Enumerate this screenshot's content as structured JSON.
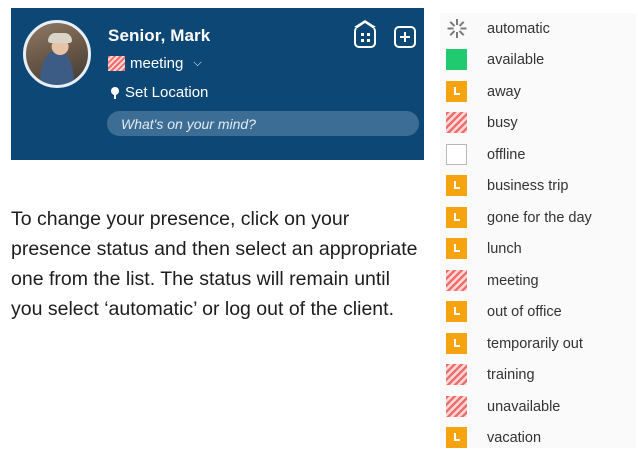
{
  "profile": {
    "name": "Senior, Mark",
    "status_label": "meeting",
    "location_label": "Set Location",
    "mind_placeholder": "What's on your mind?",
    "icons": {
      "status": "hatched-busy-swatch",
      "dropdown": "chevron-down-icon",
      "location": "map-pin-icon",
      "apps": "apps-grid-icon",
      "add": "plus-icon"
    },
    "colors": {
      "card_background": "#0d4775"
    }
  },
  "description": "To change your presence, click on your presence status and then select an appropriate one from the list. The status will remain until you select ‘automatic’ or log out of the client.",
  "statuses": [
    {
      "label": "automatic",
      "icon": "spinner-icon"
    },
    {
      "label": "available",
      "icon": "green-square"
    },
    {
      "label": "away",
      "icon": "orange-clock"
    },
    {
      "label": "busy",
      "icon": "red-hatched"
    },
    {
      "label": "offline",
      "icon": "white-square"
    },
    {
      "label": "business trip",
      "icon": "orange-clock"
    },
    {
      "label": "gone for the day",
      "icon": "orange-clock"
    },
    {
      "label": "lunch",
      "icon": "orange-clock"
    },
    {
      "label": "meeting",
      "icon": "red-hatched"
    },
    {
      "label": "out of office",
      "icon": "orange-clock"
    },
    {
      "label": "temporarily out",
      "icon": "orange-clock"
    },
    {
      "label": "training",
      "icon": "red-hatched"
    },
    {
      "label": "unavailable",
      "icon": "red-hatched"
    },
    {
      "label": "vacation",
      "icon": "orange-clock"
    }
  ],
  "status_colors": {
    "available": "#1fcb6e",
    "away": "#f5a40f",
    "busy": "#ef6f6f",
    "offline": "#ffffff"
  }
}
